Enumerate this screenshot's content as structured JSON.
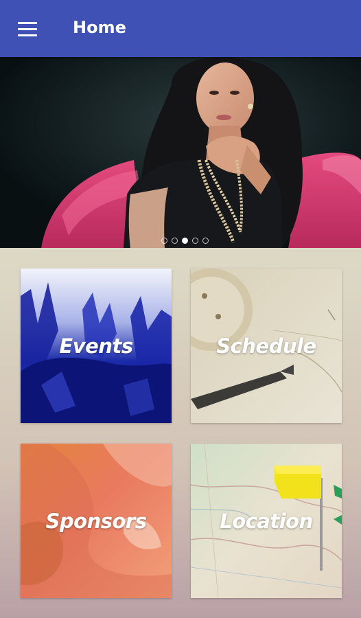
{
  "header": {
    "title": "Home",
    "menu_icon": "hamburger-menu-icon",
    "background_color": "#3f51b5"
  },
  "banner": {
    "slide_count": 5,
    "active_slide": 3
  },
  "tiles": [
    {
      "label": "Events",
      "icon": "crowd-hands-image"
    },
    {
      "label": "Schedule",
      "icon": "clock-pen-image"
    },
    {
      "label": "Sponsors",
      "icon": "abstract-gradient-image"
    },
    {
      "label": "Location",
      "icon": "map-flag-image"
    }
  ]
}
